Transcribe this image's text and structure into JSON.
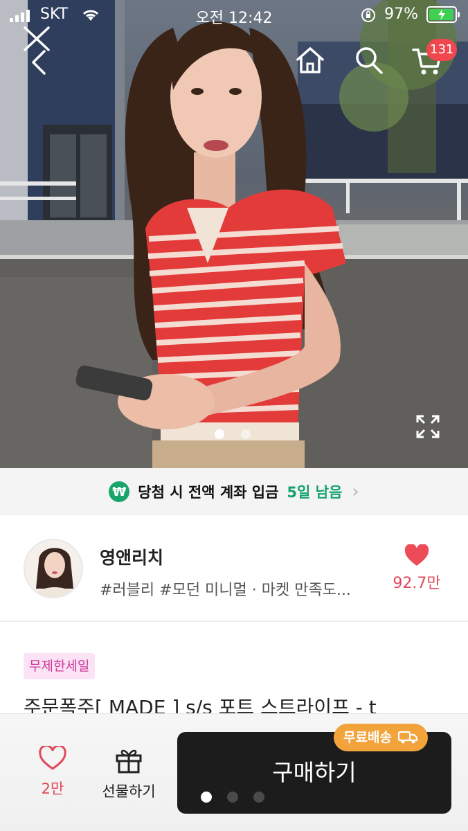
{
  "status_bar": {
    "carrier": "SKT",
    "time": "오전 12:42",
    "battery_percent": "97%",
    "battery_level": 0.97
  },
  "nav": {
    "cart_count": "131"
  },
  "gallery": {
    "image_count": 2,
    "current_index": 1
  },
  "banner": {
    "icon_symbol": "₩",
    "text": "당첨 시 전액 계좌 입금",
    "highlight": "5일 남음",
    "accent_color": "#14a36b"
  },
  "store": {
    "name": "영앤리치",
    "tags": "#러블리 #모던 미니멀 · 마켓 만족도...",
    "likes": "92.7만"
  },
  "product": {
    "badge": "무제한세일",
    "title": "주문폭주[ MADE ] s/s 포트 스트라이프 - t"
  },
  "bottom_bar": {
    "like_count": "2만",
    "gift_label": "선물하기",
    "buy_label": "구매하기",
    "shipping_badge": "무료배송",
    "page_indicator_count": 3,
    "page_indicator_active": 1
  },
  "colors": {
    "like_red": "#e1485a",
    "sale_pink": "#d0379a",
    "shipping_orange": "#f2a33b",
    "badge_red": "#f0474f",
    "buy_black": "#1c1c1c"
  }
}
